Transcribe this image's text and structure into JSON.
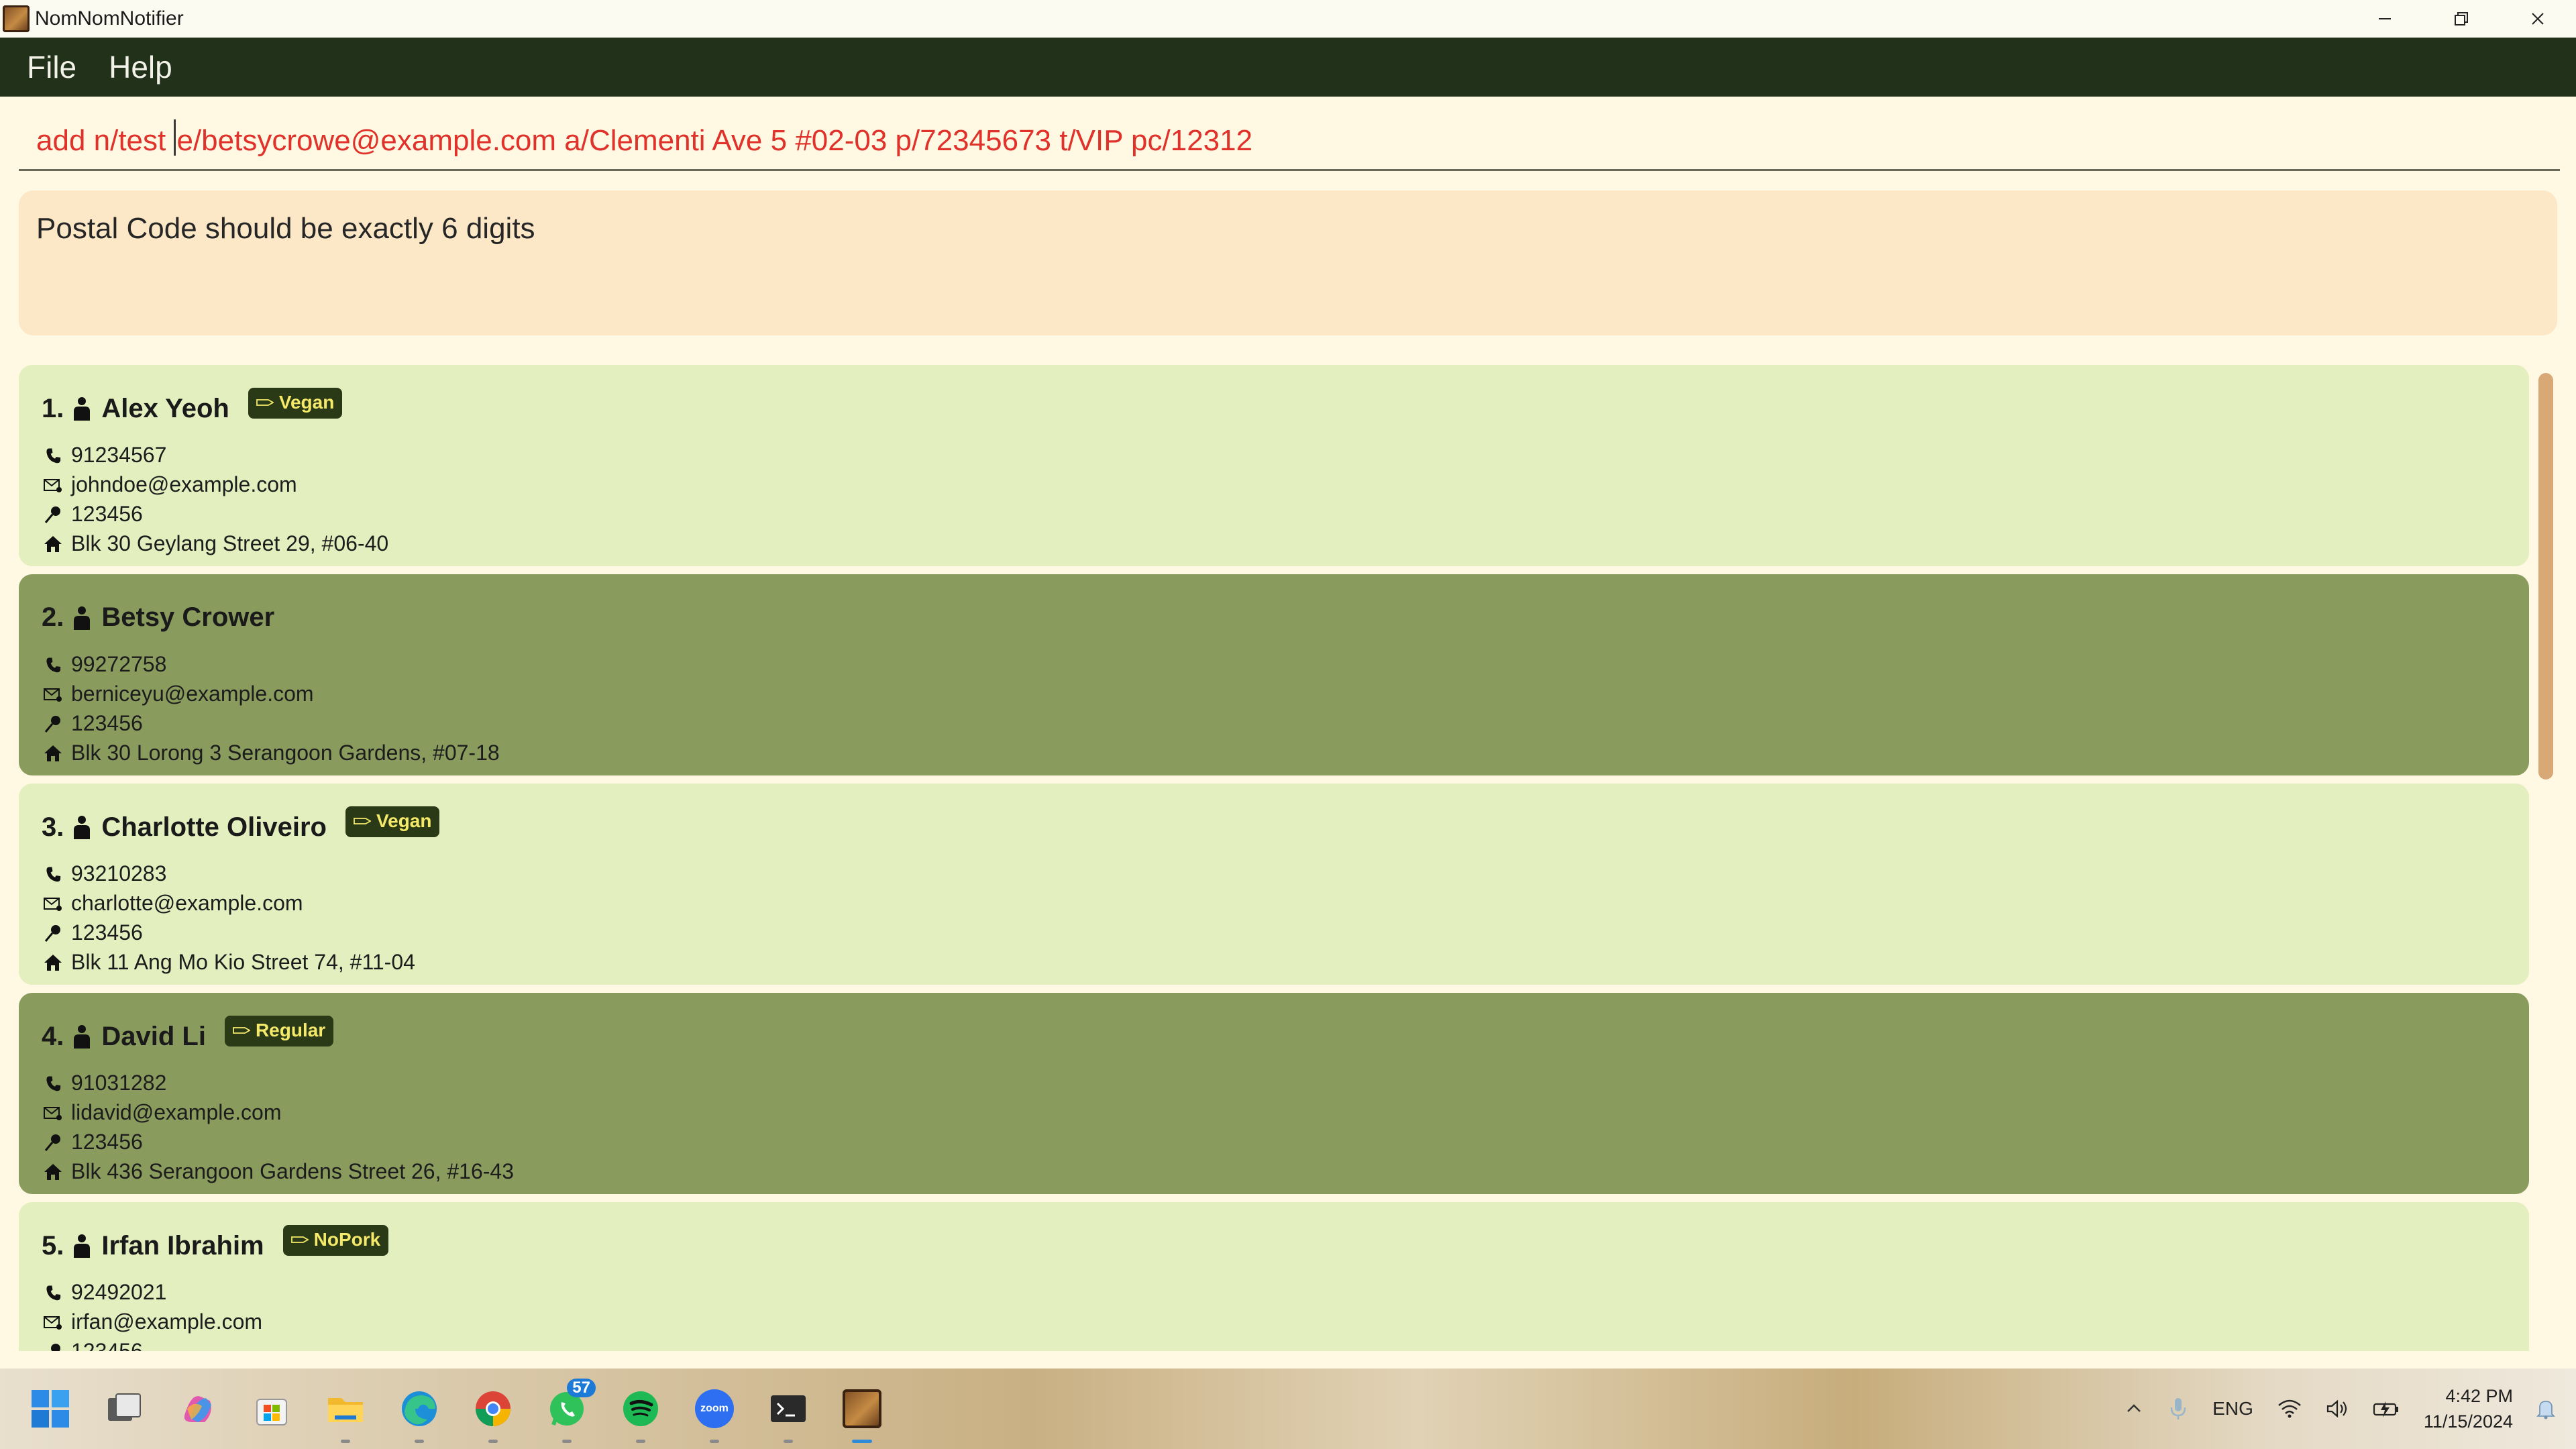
{
  "window": {
    "title": "NomNomNotifier"
  },
  "menu": {
    "items": [
      "File",
      "Help"
    ]
  },
  "command": {
    "before_caret": "add n/test ",
    "after_caret": "e/betsycrowe@example.com a/Clementi Ave 5 #02-03 p/72345673 t/VIP pc/12312"
  },
  "result": {
    "message": "Postal Code should be exactly 6 digits"
  },
  "persons": [
    {
      "index": "1.",
      "name": "Alex Yeoh",
      "tag": "Vegan",
      "phone": "91234567",
      "email": "johndoe@example.com",
      "postal": "123456",
      "address": "Blk 30 Geylang Street 29, #06-40"
    },
    {
      "index": "2.",
      "name": "Betsy Crower",
      "tag": "",
      "phone": "99272758",
      "email": "berniceyu@example.com",
      "postal": "123456",
      "address": "Blk 30 Lorong 3 Serangoon Gardens, #07-18"
    },
    {
      "index": "3.",
      "name": "Charlotte Oliveiro",
      "tag": "Vegan",
      "phone": "93210283",
      "email": "charlotte@example.com",
      "postal": "123456",
      "address": "Blk 11 Ang Mo Kio Street 74, #11-04"
    },
    {
      "index": "4.",
      "name": "David Li",
      "tag": "Regular",
      "phone": "91031282",
      "email": "lidavid@example.com",
      "postal": "123456",
      "address": "Blk 436 Serangoon Gardens Street 26, #16-43"
    },
    {
      "index": "5.",
      "name": "Irfan Ibrahim",
      "tag": "NoPork",
      "phone": "92492021",
      "email": "irfan@example.com",
      "postal": "123456",
      "address": ""
    }
  ],
  "taskbar": {
    "whatsapp_badge": "57",
    "zoom_label": "zoom",
    "language": "ENG",
    "time": "4:42 PM",
    "date": "11/15/2024"
  },
  "colors": {
    "menubar": "#22321a",
    "card_light": "#e3efbf",
    "card_dark": "#8a9b5e",
    "tag_bg": "#2a3a16",
    "tag_text": "#f5e96a",
    "command_text": "#e0322a",
    "result_bg": "#fce8c6"
  }
}
